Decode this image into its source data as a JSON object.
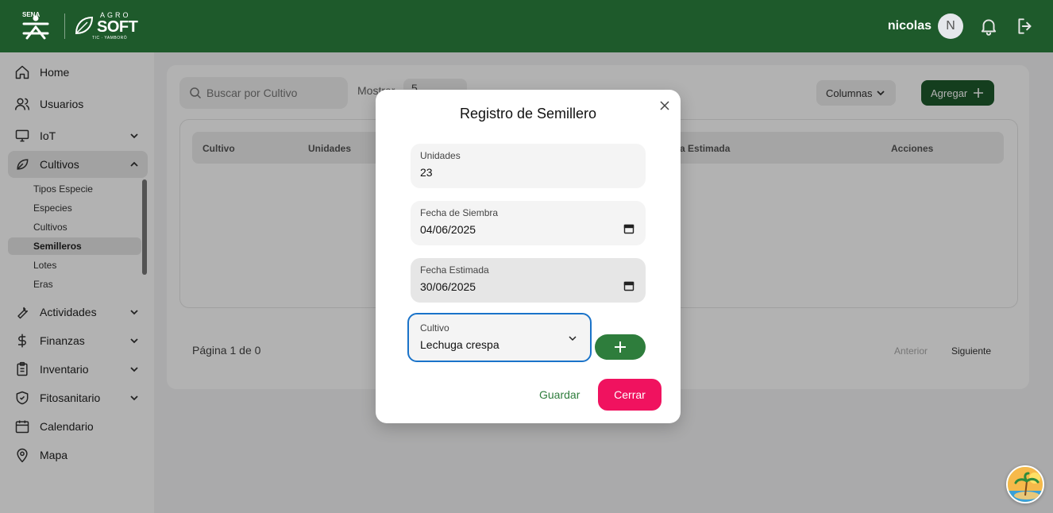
{
  "header": {
    "user_name": "nicolas",
    "avatar_initial": "N",
    "logo_text": {
      "top": "AGRO",
      "main": "SOFT",
      "sub": "TIC · YAMBORÓ",
      "sena": "SENA"
    },
    "brand_color": "#1e5a2b"
  },
  "sidebar": {
    "items": [
      {
        "label": "Home",
        "icon": "home-icon"
      },
      {
        "label": "Usuarios",
        "icon": "users-icon"
      },
      {
        "label": "IoT",
        "icon": "monitor-icon"
      },
      {
        "label": "Cultivos",
        "icon": "leaf-icon"
      },
      {
        "label": "Actividades",
        "icon": "wrench-icon"
      },
      {
        "label": "Finanzas",
        "icon": "dollar-icon"
      },
      {
        "label": "Inventario",
        "icon": "clipboard-icon"
      },
      {
        "label": "Fitosanitario",
        "icon": "shield-icon"
      },
      {
        "label": "Calendario",
        "icon": "calendar-icon"
      },
      {
        "label": "Mapa",
        "icon": "map-pin-icon"
      }
    ],
    "cultivos_sub": [
      "Tipos Especie",
      "Especies",
      "Cultivos",
      "Semilleros",
      "Lotes",
      "Eras"
    ],
    "active_sub": "Semilleros"
  },
  "main": {
    "search_placeholder": "Buscar por Cultivo",
    "mostrar_label": "Mostrar",
    "mostrar_value": "5",
    "columnas_label": "Columnas",
    "agregar_label": "Agregar",
    "table_headers": [
      "Cultivo",
      "Unidades",
      "Fecha Estimada",
      "Acciones"
    ],
    "pagination": {
      "text": "Página 1 de 0",
      "prev": "Anterior",
      "next": "Siguiente"
    }
  },
  "modal": {
    "title": "Registro de Semillero",
    "fields": [
      {
        "label": "Unidades",
        "value": "23"
      },
      {
        "label": "Fecha de Siembra",
        "value": "04/06/2025"
      },
      {
        "label": "Fecha Estimada",
        "value": "30/06/2025"
      }
    ],
    "cultivo": {
      "label": "Cultivo",
      "value": "Lechuga crespa"
    },
    "guardar_label": "Guardar",
    "cerrar_label": "Cerrar",
    "accent_color": "#f0125f"
  }
}
